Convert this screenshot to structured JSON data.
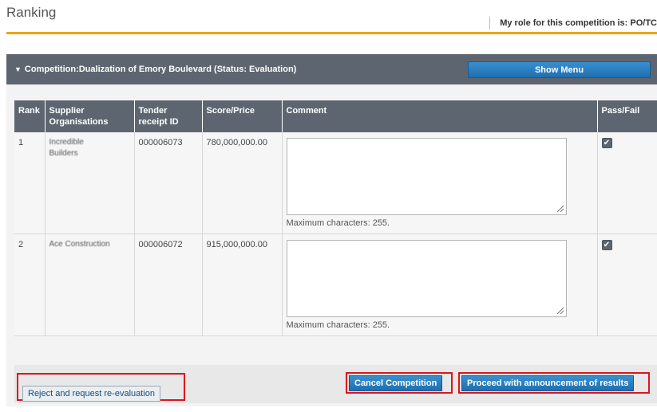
{
  "header": {
    "title": "Ranking",
    "role_text": "My role for this competition is: PO/TC"
  },
  "competition": {
    "title": "Competition:Dualization of Emory Boulevard (Status: Evaluation)",
    "show_menu_label": "Show Menu"
  },
  "table": {
    "columns": [
      "Rank",
      "Supplier Organisations",
      "Tender receipt ID",
      "Score/Price",
      "Comment",
      "Pass/Fail"
    ],
    "rows": [
      {
        "rank": "1",
        "supplier_line1": "Incredible",
        "supplier_line2": "Builders",
        "tender_id": "000006073",
        "score": "780,000,000.00",
        "comment": "",
        "max_chars": "Maximum characters: 255.",
        "pass": true
      },
      {
        "rank": "2",
        "supplier_line1": "Ace Construction",
        "supplier_line2": "",
        "tender_id": "000006072",
        "score": "915,000,000.00",
        "comment": "",
        "max_chars": "Maximum characters: 255.",
        "pass": true
      }
    ]
  },
  "actions": {
    "reject_label": "Reject and request re-evaluation",
    "cancel_label": "Cancel Competition",
    "proceed_label": "Proceed with announcement of results"
  },
  "colors": {
    "accent_orange": "#f0a300",
    "header_gray": "#5d6670",
    "button_blue": "#1f6fb0",
    "highlight_red": "#e0121e"
  }
}
